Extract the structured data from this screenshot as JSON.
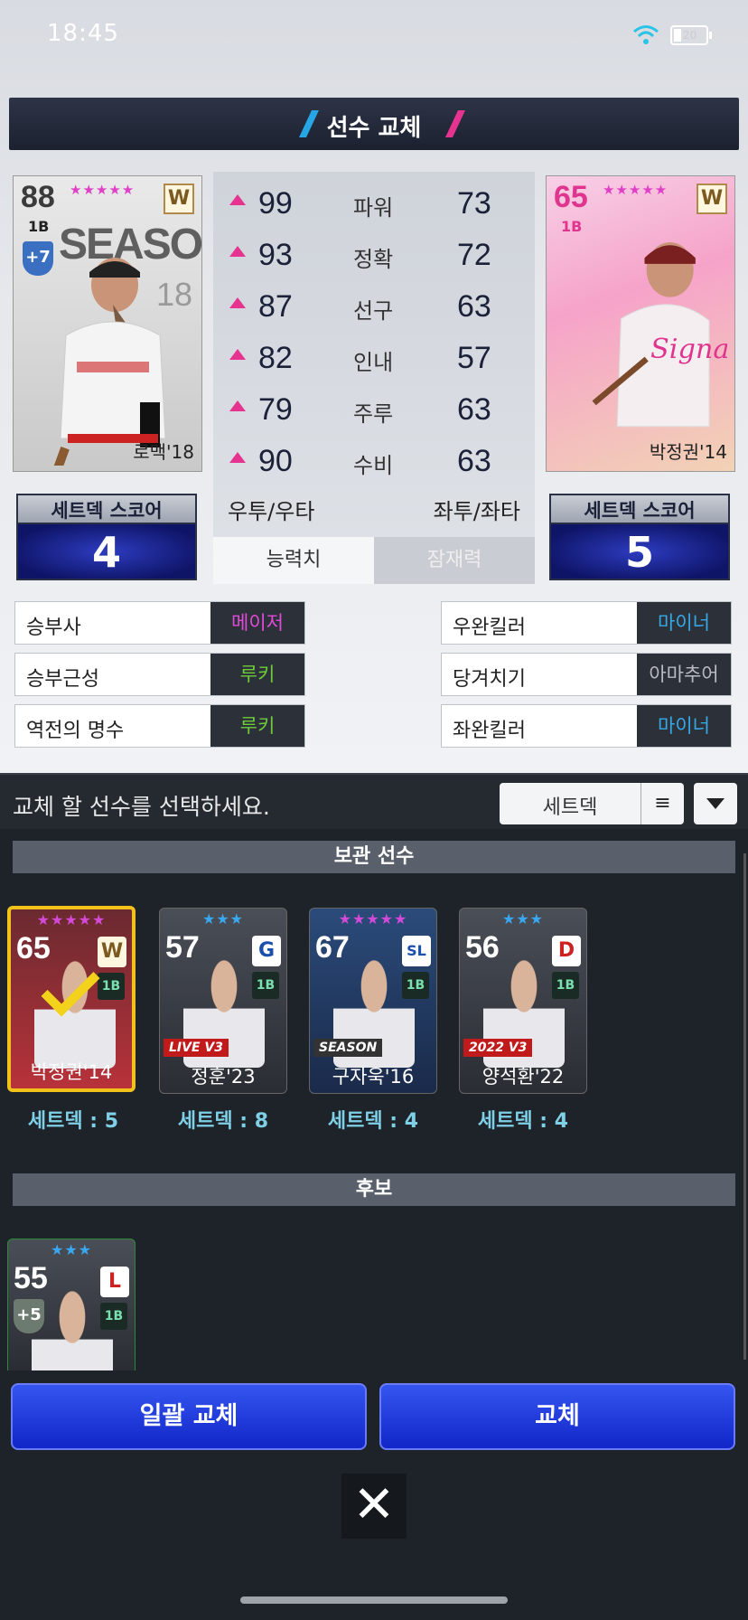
{
  "status": {
    "time": "18:45",
    "battery": "20"
  },
  "title": "선수 교체",
  "left_card": {
    "ovr": "88",
    "pos": "1B",
    "stars": "★★★★★",
    "badge": "W",
    "boost": "+7",
    "season": "SEASON",
    "num": "18",
    "name": "로맥'18"
  },
  "right_card": {
    "ovr": "65",
    "pos": "1B",
    "stars": "★★★★★",
    "badge": "W",
    "name": "박정권'14"
  },
  "stats": [
    {
      "left": "99",
      "label": "파워",
      "right": "73"
    },
    {
      "left": "93",
      "label": "정확",
      "right": "72"
    },
    {
      "left": "87",
      "label": "선구",
      "right": "63"
    },
    {
      "left": "82",
      "label": "인내",
      "right": "57"
    },
    {
      "left": "79",
      "label": "주루",
      "right": "63"
    },
    {
      "left": "90",
      "label": "수비",
      "right": "63"
    }
  ],
  "hand": {
    "left": "우투/우타",
    "right": "좌투/좌타"
  },
  "tabs": {
    "ability": "능력치",
    "potential": "잠재력"
  },
  "setdeck_left": {
    "label": "세트덱 스코어",
    "value": "4"
  },
  "setdeck_right": {
    "label": "세트덱 스코어",
    "value": "5"
  },
  "skills_left": [
    {
      "name": "승부사",
      "level": "메이저",
      "color": "#e04bd8"
    },
    {
      "name": "승부근성",
      "level": "루키",
      "color": "#6ecb3a"
    },
    {
      "name": "역전의 명수",
      "level": "루키",
      "color": "#6ecb3a"
    }
  ],
  "skills_right": [
    {
      "name": "우완킬러",
      "level": "마이너",
      "color": "#36a8e6"
    },
    {
      "name": "당겨치기",
      "level": "아마추어",
      "color": "#b9bcc2"
    },
    {
      "name": "좌완킬러",
      "level": "마이너",
      "color": "#36a8e6"
    }
  ],
  "prompt": "교체 할 선수를 선택하세요.",
  "sort": {
    "label": "세트덱",
    "menu_icon": "≡"
  },
  "sections": {
    "stored": "보관 선수",
    "bench": "후보"
  },
  "stored_players": [
    {
      "ovr": "65",
      "stars": "★★★★★",
      "star_color": "#d44ad8",
      "pos": "1B",
      "team": "W",
      "name": "박정권'14",
      "deck": "세트덱 : 5",
      "selected": true
    },
    {
      "ovr": "57",
      "stars": "★★★",
      "star_color": "#3aa8f0",
      "pos": "1B",
      "team": "G",
      "name": "정훈'23",
      "deck": "세트덱 : 8",
      "tag": "LIVE V3"
    },
    {
      "ovr": "67",
      "stars": "★★★★★",
      "star_color": "#d44ad8",
      "pos": "1B",
      "team": "SL",
      "name": "구자욱'16",
      "deck": "세트덱 : 4",
      "tag": "SEASON"
    },
    {
      "ovr": "56",
      "stars": "★★★",
      "star_color": "#3aa8f0",
      "pos": "1B",
      "team": "D",
      "name": "양석환'22",
      "deck": "세트덱 : 4",
      "tag": "2022 V3"
    }
  ],
  "bench_player": {
    "ovr": "55",
    "stars": "★★★",
    "boost": "+5",
    "pos": "1B",
    "team": "L"
  },
  "buttons": {
    "bulk": "일괄 교체",
    "swap": "교체",
    "close": "✕"
  }
}
